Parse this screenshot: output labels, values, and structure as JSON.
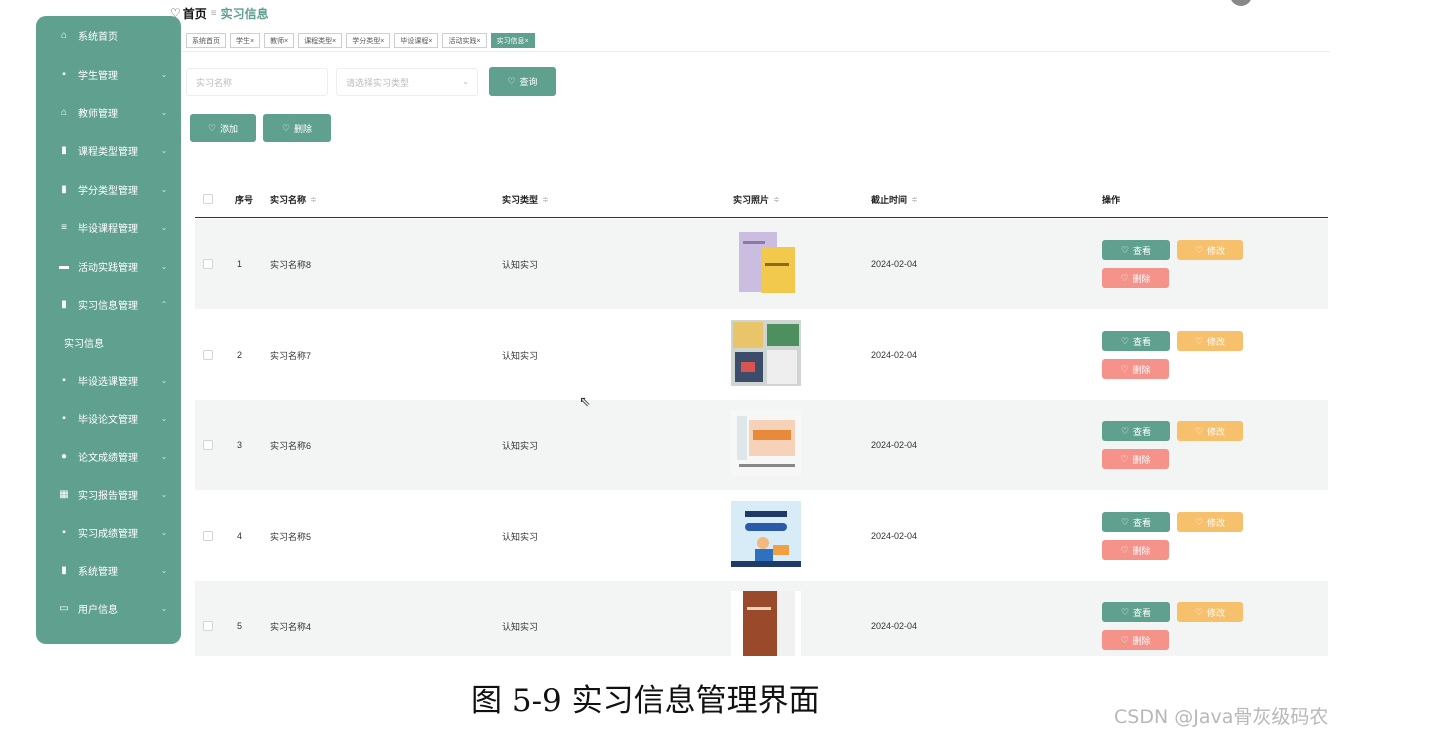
{
  "breadcrumb": {
    "home": "首页",
    "separator": "≡",
    "current": "实习信息"
  },
  "sidebar": {
    "items": [
      {
        "label": "系统首页",
        "icon": "home-icon",
        "glyph": "⌂",
        "chevron": ""
      },
      {
        "label": "学生管理",
        "icon": "grid-icon",
        "glyph": "▪",
        "chevron": "⌄"
      },
      {
        "label": "教师管理",
        "icon": "bank-icon",
        "glyph": "⌂",
        "chevron": "⌄"
      },
      {
        "label": "课程类型管理",
        "icon": "clipboard-icon",
        "glyph": "▮",
        "chevron": "⌄"
      },
      {
        "label": "学分类型管理",
        "icon": "chart-icon",
        "glyph": "▮",
        "chevron": "⌄"
      },
      {
        "label": "毕设课程管理",
        "icon": "list-icon",
        "glyph": "≡",
        "chevron": "⌄"
      },
      {
        "label": "活动实践管理",
        "icon": "database-icon",
        "glyph": "▬",
        "chevron": "⌄"
      },
      {
        "label": "实习信息管理",
        "icon": "clipboard-icon",
        "glyph": "▮",
        "chevron": "⌃"
      },
      {
        "label": "毕设选课管理",
        "icon": "grid-icon",
        "glyph": "▪",
        "chevron": "⌄"
      },
      {
        "label": "毕设论文管理",
        "icon": "grid-icon",
        "glyph": "▪",
        "chevron": "⌄"
      },
      {
        "label": "论文成绩管理",
        "icon": "location-icon",
        "glyph": "●",
        "chevron": "⌄"
      },
      {
        "label": "实习报告管理",
        "icon": "table-icon",
        "glyph": "▦",
        "chevron": "⌄"
      },
      {
        "label": "实习成绩管理",
        "icon": "grid-icon",
        "glyph": "▪",
        "chevron": "⌄"
      },
      {
        "label": "系统管理",
        "icon": "bar-chart-icon",
        "glyph": "▮",
        "chevron": "⌄"
      },
      {
        "label": "用户信息",
        "icon": "card-icon",
        "glyph": "▭",
        "chevron": "⌄"
      }
    ],
    "sub_item": "实习信息"
  },
  "tags": [
    "系统首页",
    "学生×",
    "教师×",
    "课程类型×",
    "学分类型×",
    "毕设课程×",
    "活动实践×",
    "实习信息×"
  ],
  "search": {
    "name_placeholder": "实习名称",
    "type_placeholder": "请选择实习类型",
    "query_label": "查询"
  },
  "actions": {
    "add_label": "添加",
    "delete_label": "删除"
  },
  "table": {
    "headers": {
      "index": "序号",
      "name": "实习名称",
      "type": "实习类型",
      "photo": "实习照片",
      "deadline": "截止时间",
      "ops": "操作"
    },
    "sort_glyph": "≑",
    "rows": [
      {
        "index": "1",
        "name": "实习名称8",
        "type": "认知实习",
        "deadline": "2024-02-04"
      },
      {
        "index": "2",
        "name": "实习名称7",
        "type": "认知实习",
        "deadline": "2024-02-04"
      },
      {
        "index": "3",
        "name": "实习名称6",
        "type": "认知实习",
        "deadline": "2024-02-04"
      },
      {
        "index": "4",
        "name": "实习名称5",
        "type": "认知实习",
        "deadline": "2024-02-04"
      },
      {
        "index": "5",
        "name": "实习名称4",
        "type": "认知实习",
        "deadline": "2024-02-04"
      }
    ],
    "row_buttons": {
      "view": "查看",
      "edit": "修改",
      "delete": "删除"
    }
  },
  "caption": "图 5-9 实习信息管理界面",
  "watermark": "CSDN @Java骨灰级码农",
  "colors": {
    "accent": "#5fa08f",
    "orange": "#f7c06c",
    "red": "#f5928a"
  }
}
